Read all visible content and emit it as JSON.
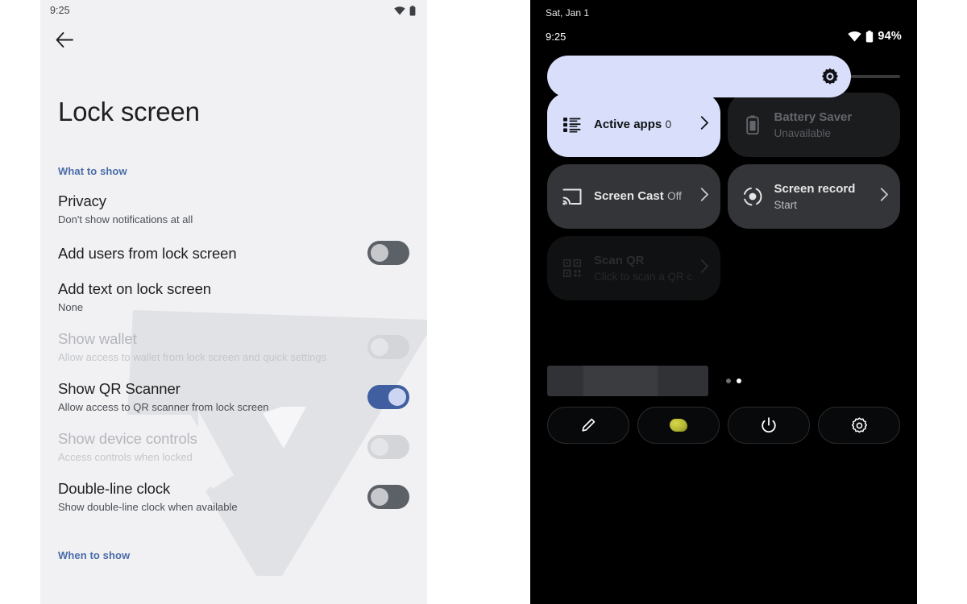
{
  "left_phone": {
    "status_bar": {
      "clock": "9:25",
      "wifi_icon": "wifi-icon",
      "battery_icon": "battery-icon"
    },
    "back_icon": "back-arrow-icon",
    "page_title": "Lock screen",
    "sections": [
      {
        "heading": "What to show"
      },
      {
        "heading": "When to show"
      }
    ],
    "items": [
      {
        "title": "Privacy",
        "subtitle": "Don't show notifications at all",
        "control": "none",
        "state": "enabled"
      },
      {
        "title": "Add users from lock screen",
        "subtitle": "",
        "control": "toggle",
        "toggle": "off",
        "state": "enabled"
      },
      {
        "title": "Add text on lock screen",
        "subtitle": "None",
        "control": "none",
        "state": "enabled"
      },
      {
        "title": "Show wallet",
        "subtitle": "Allow access to wallet from lock screen and quick settings",
        "control": "toggle",
        "toggle": "disabled",
        "state": "disabled"
      },
      {
        "title": "Show QR Scanner",
        "subtitle": "Allow access to QR scanner from lock screen",
        "control": "toggle",
        "toggle": "on",
        "state": "enabled"
      },
      {
        "title": "Show device controls",
        "subtitle": "Access controls when locked",
        "control": "toggle",
        "toggle": "disabled",
        "state": "disabled"
      },
      {
        "title": "Double-line clock",
        "subtitle": "Show double-line clock when available",
        "control": "toggle",
        "toggle": "off",
        "state": "enabled"
      }
    ],
    "colors": {
      "background": "#f1f1f4",
      "section_heading": "#4a6da7",
      "toggle_on": "#3f5fa0",
      "toggle_on_knob": "#ccd5f2",
      "toggle_off": "#5c6067",
      "toggle_disabled": "#d4d5d9"
    }
  },
  "right_phone": {
    "date": "Sat, Jan 1",
    "status_bar": {
      "clock": "9:25",
      "wifi_icon": "wifi-icon",
      "battery_icon": "battery-icon",
      "battery_percent": "94%"
    },
    "brightness": {
      "icon": "brightness-sun-icon",
      "level_percent": 86
    },
    "tiles": [
      {
        "title": "Active apps",
        "subtitle": "0",
        "icon": "list-icon",
        "chevron": "chevron-right-icon",
        "state": "active"
      },
      {
        "title": "Battery Saver",
        "subtitle": "Unavailable",
        "icon": "battery-icon",
        "chevron": "",
        "state": "unavailable"
      },
      {
        "title": "Screen Cast",
        "subtitle": "Off",
        "icon": "cast-icon",
        "chevron": "chevron-right-icon",
        "state": "inactive"
      },
      {
        "title": "Screen record",
        "subtitle": "Start",
        "icon": "record-icon",
        "chevron": "chevron-right-icon",
        "state": "inactive"
      },
      {
        "title": "Scan QR",
        "subtitle": "Click to scan a QR c",
        "icon": "qr-code-icon",
        "chevron": "chevron-right-icon",
        "state": "fading"
      }
    ],
    "pager": {
      "total": 2,
      "current": 2
    },
    "footer_buttons": [
      {
        "icon": "pencil-edit-icon",
        "name": "edit-tiles-button"
      },
      {
        "icon": "user-avatar-icon",
        "name": "user-switch-button"
      },
      {
        "icon": "power-icon",
        "name": "power-button"
      },
      {
        "icon": "gear-icon",
        "name": "settings-button"
      }
    ],
    "colors": {
      "background": "#000000",
      "tile_active": "#d9dffb",
      "tile_inactive": "#333538",
      "tile_unavailable": "#1b1c1e"
    }
  }
}
